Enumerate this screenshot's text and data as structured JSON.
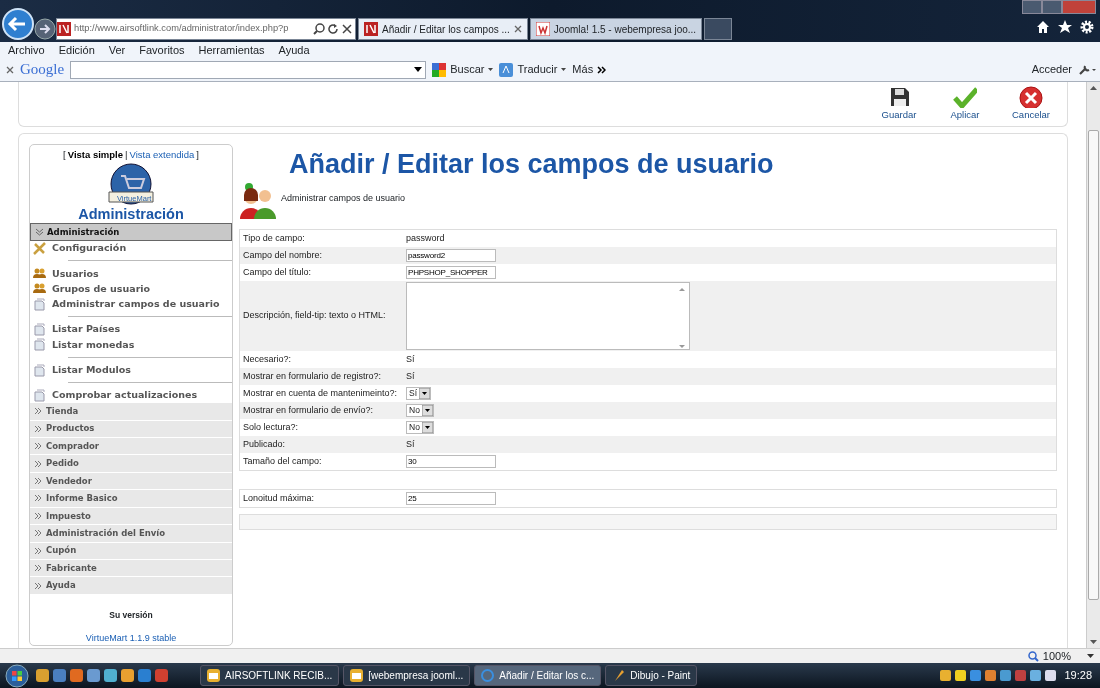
{
  "browser": {
    "address": "http://www.airsoftlink.com/administrator/index.php?p",
    "tabs": [
      {
        "title": "Añadir / Editar los campos ...",
        "selected": true
      },
      {
        "title": "Joomla! 1.5 - webempresa joo...",
        "selected": false
      }
    ],
    "menu": [
      "Archivo",
      "Edición",
      "Ver",
      "Favoritos",
      "Herramientas",
      "Ayuda"
    ],
    "google_toolbar": {
      "brand": "Google",
      "search": "Buscar",
      "translate": "Traducir",
      "more": "Más",
      "signin": "Acceder"
    }
  },
  "toolbar": [
    {
      "label": "Guardar",
      "kind": "save"
    },
    {
      "label": "Aplicar",
      "kind": "apply"
    },
    {
      "label": "Cancelar",
      "kind": "cancel"
    }
  ],
  "sidebar": {
    "bracket_open": "[",
    "view_separator": "|",
    "bracket_close": "]",
    "views": [
      {
        "label": "Vista simple",
        "selected": true
      },
      {
        "label": "Vista extendida",
        "selected": false
      }
    ],
    "logo_text": "VirtueMart",
    "title": "Administración",
    "sections": [
      {
        "label": "Administración",
        "expanded": true,
        "groups": [
          [
            {
              "label": "Configuración",
              "kind": "config"
            }
          ],
          [
            {
              "label": "Usuarios",
              "kind": "users"
            },
            {
              "label": "Grupos de usuario",
              "kind": "users"
            },
            {
              "label": "Administrar campos de usuario",
              "kind": "page"
            }
          ],
          [
            {
              "label": "Listar Países",
              "kind": "page"
            },
            {
              "label": "Listar monedas",
              "kind": "page"
            }
          ],
          [
            {
              "label": "Listar Modulos",
              "kind": "page"
            }
          ],
          [
            {
              "label": "Comprobar actualizaciones",
              "kind": "page"
            }
          ]
        ]
      },
      {
        "label": "Tienda",
        "expanded": false
      },
      {
        "label": "Productos",
        "expanded": false
      },
      {
        "label": "Comprador",
        "expanded": false
      },
      {
        "label": "Pedido",
        "expanded": false
      },
      {
        "label": "Vendedor",
        "expanded": false
      },
      {
        "label": "Informe Basico",
        "expanded": false
      },
      {
        "label": "Impuesto",
        "expanded": false
      },
      {
        "label": "Administración del Envío",
        "expanded": false
      },
      {
        "label": "Cupón",
        "expanded": false
      },
      {
        "label": "Fabricante",
        "expanded": false
      },
      {
        "label": "Ayuda",
        "expanded": false
      }
    ],
    "version_label": "Su versión",
    "version": "VirtueMart 1.1.9 stable"
  },
  "form": {
    "title": "Añadir / Editar los campos de usuario",
    "subtitle": "Administrar campos de usuario",
    "rows": [
      {
        "label": "Tipo de campo:",
        "kind": "text",
        "value": "password"
      },
      {
        "label": "Campo del nombre:",
        "kind": "input",
        "value": "password2"
      },
      {
        "label": "Campo del título:",
        "kind": "input",
        "value": "PHPSHOP_SHOPPER"
      },
      {
        "label": "Descripción, field-tip: texto o HTML:",
        "kind": "textarea"
      },
      {
        "label": "Necesario?:",
        "kind": "text",
        "value": "Sí"
      },
      {
        "label": "Mostrar en formulario de registro?:",
        "kind": "text",
        "value": "Sí"
      },
      {
        "label": "Mostrar en cuenta de mantenimeinto?:",
        "kind": "select",
        "value": "Sí"
      },
      {
        "label": "Mostrar en formulario de envío?:",
        "kind": "select",
        "value": "No"
      },
      {
        "label": "Solo lectura?:",
        "kind": "select",
        "value": "No"
      },
      {
        "label": "Publicado:",
        "kind": "text",
        "value": "Sí"
      },
      {
        "label": "Tamaño del campo:",
        "kind": "input",
        "value": "30"
      }
    ],
    "rows_2": [
      {
        "label": "Lonoitud máxima:",
        "kind": "input",
        "value": "25"
      }
    ]
  },
  "status_bar": {
    "zoom": "100%"
  },
  "taskbar": {
    "tasks": [
      {
        "label": "AIRSOFTLINK RECIB...",
        "kind": "mail",
        "selected": false
      },
      {
        "label": "[webempresa jooml...",
        "kind": "mail",
        "selected": false
      },
      {
        "label": "Añadir / Editar los c...",
        "kind": "browser",
        "selected": true
      },
      {
        "label": "Dibujo - Paint",
        "kind": "paint",
        "selected": false
      }
    ],
    "clock": "19:28"
  }
}
